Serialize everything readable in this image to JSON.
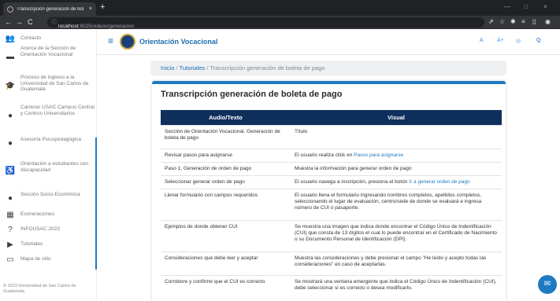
{
  "browser": {
    "tab_title": "Transcripción generación de bol",
    "tab_close": "×",
    "new_tab": "+",
    "url_host": "localhost",
    "url_rest": ":8025/videos/generacion",
    "win_min": "—",
    "win_max": "□",
    "win_close": "×"
  },
  "header": {
    "site_title": "Orientación Vocacional",
    "tool_a": "A",
    "tool_a_plus": "A+",
    "tool_dots": "◎",
    "tool_search": "Q"
  },
  "sidebar": {
    "items": [
      {
        "label": "Contacto",
        "icon": "people-icon"
      },
      {
        "label": "Acerca de la Sección de Orientación Vocacional",
        "icon": "book-icon"
      },
      {
        "label": "Proceso de ingreso a la Universidad de San Carlos de Guatemala",
        "icon": "graduation-cap-icon"
      },
      {
        "label": "Carreras USAC Campus Central y Centros Universitarios",
        "icon": "info-icon"
      },
      {
        "label": "Asesoría Psicopedagógica",
        "icon": "info-icon"
      },
      {
        "label": "Orientación a estudiantes con discapacidad",
        "icon": "accessibility-icon"
      },
      {
        "label": "Sección Socio-Económica",
        "icon": "info-icon"
      },
      {
        "label": "Exoneraciones",
        "icon": "grid-icon"
      },
      {
        "label": "INFOUSAC 2023",
        "icon": "question-icon"
      },
      {
        "label": "Tutoriales",
        "icon": "video-icon"
      },
      {
        "label": "Mapa de sitio",
        "icon": "map-icon"
      }
    ],
    "footer": "© 2023 Universidad de San Carlos de Guatemala"
  },
  "breadcrumb": {
    "home": "Inicio",
    "tutorials": "Tutoriales",
    "sep": "/",
    "current": "Transcripción generación de boleta de pago"
  },
  "page_title": "Transcripción generación de boleta de pago",
  "table": {
    "headers": [
      "Audio/Texto",
      "Visual"
    ],
    "rows": [
      {
        "audio": "Sección de Orientación Vocacional, Generación de boleta de pago",
        "visual": "Título"
      },
      {
        "audio": "Revisar pasos para asignarse",
        "visual_pre": "El usuario realiza click en ",
        "visual_link": "Pasos para asignarse"
      },
      {
        "audio": "Paso 1, Generación de orden de pago",
        "visual": "Muestra la información para generar orden de pago"
      },
      {
        "audio": "Seleccionar generar orden de pago",
        "visual_pre": "El usuario navega a inscripción, presiona el botón ",
        "visual_link": "Ir a generar orden de pago"
      },
      {
        "audio": "Llenar formulario con campos requeridos",
        "visual": "El usuario llena el formulario ingresando nombres completos, apellidos completos, seleccionando el lugar de evaluación, centro/sede de donde se evaluará e ingresa número de CUI o pasaporte."
      },
      {
        "audio": "Ejemplos de donde obtener CUI",
        "visual": "Se muestra una imagen que indica donde encontrar el Código Único de Indentificación (CUI) que consta de 13 dígitos el cual lo puede encontrar en el Certificado de Nacimiento o su Documento Personal de Identificación (DPI)."
      },
      {
        "audio": "Consideraciones que debe leer y aceptar",
        "visual": "Muestra las consideraciones y debe presionar el campo \"He leído y acepto todas las consideraciones\" en caso de aceptarlas."
      },
      {
        "audio": "Corrobore y confirme que el CUI es correcto",
        "visual": "Se mostrará una ventana emergente que indica el Código Único de Indentificación (CUI), debe seleccionar si es correcto o desea modificarlo."
      }
    ]
  },
  "chat_icon": "chat-bubble-icon"
}
